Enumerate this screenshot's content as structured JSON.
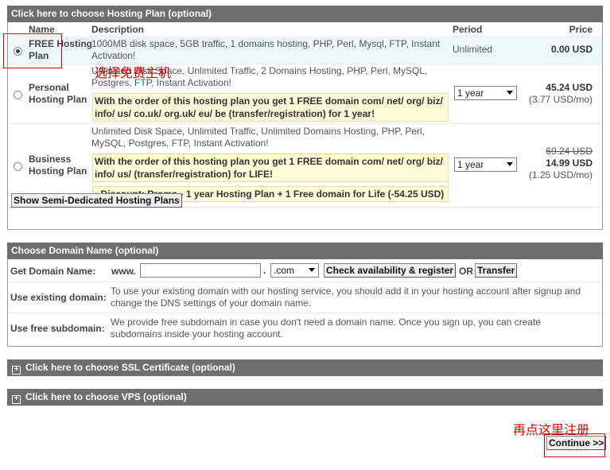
{
  "hosting": {
    "header": "Click here to choose Hosting Plan (optional)",
    "columns": {
      "name": "Name",
      "description": "Description",
      "period": "Period",
      "price": "Price"
    },
    "plans": [
      {
        "name_line1": "FREE Hosting",
        "name_line2": "Plan",
        "selected": true,
        "desc_line1": "1000MB disk space, 5GB traffic, 1 domains hosting, PHP, Perl, Mysql, FTP, Instant",
        "desc_line2": "Activation!",
        "period": "Unlimited",
        "price": "0.00 USD"
      },
      {
        "name_line1": "Personal",
        "name_line2": "Hosting Plan",
        "selected": false,
        "desc_line1": "Unlimited Disk Space, Unlimited Traffic, 2 Domains Hosting, PHP, Perl, MySQL,",
        "desc_line2": "Postgres, FTP, Instant Activation!",
        "promo_line1": "With the order of this hosting plan you get 1 FREE domain com/ net/ org/ biz/",
        "promo_line2": "info/ us/ co.uk/ org.uk/ eu/ be (transfer/registration) for 1 year!",
        "period": "1 year",
        "price": "45.24 USD",
        "price_sub": "(3.77 USD/mo)"
      },
      {
        "name_line1": "Business",
        "name_line2": "Hosting Plan",
        "selected": false,
        "desc_line1": "Unlimited Disk Space, Unlimited Traffic, Unlimited Domains Hosting, PHP, Perl,",
        "desc_line2": "MySQL, Postgres, FTP, Instant Activation!",
        "promo_line1": "With the order of this hosting plan you get 1 FREE domain com/ net/ org/ biz/",
        "promo_line2": "info/ us/ (transfer/registration) for LIFE!",
        "discount": "• Discount: Promo - 1 year Hosting Plan + 1 Free domain for Life (-54.25 USD)",
        "period": "1 year",
        "price_old": "69.24 USD",
        "price": "14.99 USD",
        "price_sub": "(1.25 USD/mo)"
      }
    ],
    "semi_button": "Show Semi-Dedicated Hosting Plans"
  },
  "domain": {
    "header": "Choose Domain Name (optional)",
    "get_label": "Get Domain Name:",
    "www": "www.",
    "input_value": "",
    "dot": ".",
    "tld": ".com",
    "check_button": "Check availability & register",
    "or": "OR",
    "transfer_button": "Transfer",
    "existing_label": "Use existing domain:",
    "existing_line1": "To use your existing domain with our hosting service, you should add it in your hosting account after signup and",
    "existing_line2": "change the DNS settings of your domain name.",
    "free_label": "Use free subdomain:",
    "free_line1": "We provide free subdomain in case you don't need a domain name. Once you sign up, you can create",
    "free_line2": "subdomains inside your hosting account."
  },
  "ssl": {
    "header": "Click here to choose SSL Certificate (optional)",
    "icon": "plus-icon"
  },
  "vps": {
    "header": "Click here to choose VPS (optional)",
    "icon": "plus-icon"
  },
  "annotations": {
    "choose_free": "选择免费主机",
    "click_here": "再点这里注册",
    "color": "#dd0000"
  },
  "continue_button": "Continue >>"
}
